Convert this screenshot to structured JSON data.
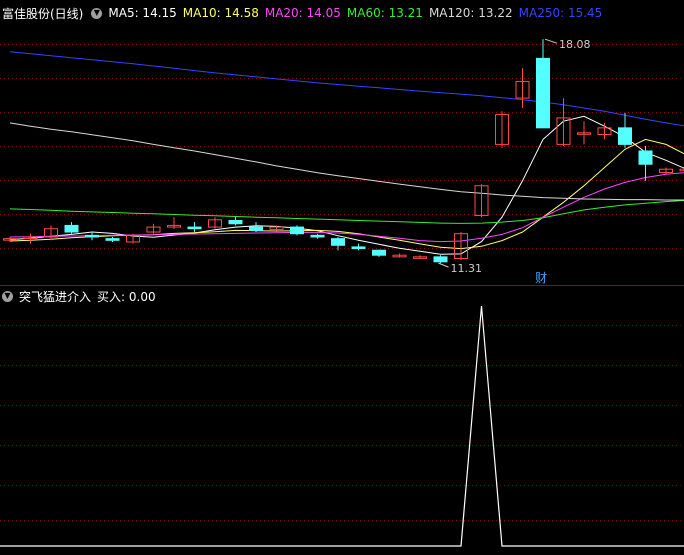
{
  "stock_name": "富佳股份(日线)",
  "ma_legend": [
    {
      "label": "MA5: 14.15",
      "color": "#ffffff"
    },
    {
      "label": "MA10: 14.58",
      "color": "#ffff66"
    },
    {
      "label": "MA20: 14.05",
      "color": "#ff44ff"
    },
    {
      "label": "MA60: 13.21",
      "color": "#33ee33"
    },
    {
      "label": "MA120: 13.22",
      "color": "#d8d8d8"
    },
    {
      "label": "MA250: 15.45",
      "color": "#3344ff"
    }
  ],
  "indicator_name": "突飞猛进介入",
  "indicator_value": "买入: 0.00",
  "annotations": {
    "high": "18.08",
    "low": "11.31",
    "marker": "财"
  },
  "colors": {
    "up": "#ff4a4a",
    "down": "#54ffff",
    "grid": "#8a0000",
    "marker": "#3aa0ff"
  },
  "chart_data": {
    "type": "candlestick",
    "price_range": [
      10.8,
      18.6
    ],
    "candles": [
      {
        "o": 12.05,
        "c": 12.05,
        "h": 12.1,
        "l": 11.95
      },
      {
        "o": 12.08,
        "c": 12.1,
        "h": 12.2,
        "l": 11.9
      },
      {
        "o": 12.1,
        "c": 12.35,
        "h": 12.45,
        "l": 12.0
      },
      {
        "o": 12.45,
        "c": 12.25,
        "h": 12.55,
        "l": 12.2
      },
      {
        "o": 12.15,
        "c": 12.1,
        "h": 12.25,
        "l": 12.0
      },
      {
        "o": 12.05,
        "c": 12.0,
        "h": 12.1,
        "l": 11.95
      },
      {
        "o": 11.95,
        "c": 12.15,
        "h": 12.2,
        "l": 11.9
      },
      {
        "o": 12.25,
        "c": 12.4,
        "h": 12.5,
        "l": 12.2
      },
      {
        "o": 12.4,
        "c": 12.45,
        "h": 12.7,
        "l": 12.35
      },
      {
        "o": 12.4,
        "c": 12.35,
        "h": 12.55,
        "l": 12.25
      },
      {
        "o": 12.4,
        "c": 12.62,
        "h": 12.7,
        "l": 12.35
      },
      {
        "o": 12.6,
        "c": 12.5,
        "h": 12.7,
        "l": 12.45
      },
      {
        "o": 12.4,
        "c": 12.3,
        "h": 12.55,
        "l": 12.25
      },
      {
        "o": 12.33,
        "c": 12.4,
        "h": 12.45,
        "l": 12.3
      },
      {
        "o": 12.4,
        "c": 12.2,
        "h": 12.45,
        "l": 12.15
      },
      {
        "o": 12.15,
        "c": 12.1,
        "h": 12.2,
        "l": 12.05
      },
      {
        "o": 12.05,
        "c": 11.85,
        "h": 12.1,
        "l": 11.7
      },
      {
        "o": 11.8,
        "c": 11.75,
        "h": 11.9,
        "l": 11.7
      },
      {
        "o": 11.7,
        "c": 11.55,
        "h": 11.72,
        "l": 11.5
      },
      {
        "o": 11.5,
        "c": 11.55,
        "h": 11.6,
        "l": 11.48
      },
      {
        "o": 11.48,
        "c": 11.5,
        "h": 11.55,
        "l": 11.45
      },
      {
        "o": 11.5,
        "c": 11.35,
        "h": 11.55,
        "l": 11.31
      },
      {
        "o": 11.45,
        "c": 12.2,
        "h": 12.25,
        "l": 11.4
      },
      {
        "o": 12.75,
        "c": 13.65,
        "h": 13.7,
        "l": 12.7
      },
      {
        "o": 14.9,
        "c": 15.8,
        "h": 15.9,
        "l": 14.8
      },
      {
        "o": 16.3,
        "c": 16.8,
        "h": 17.2,
        "l": 16.0
      },
      {
        "o": 17.5,
        "c": 15.4,
        "h": 18.08,
        "l": 15.4
      },
      {
        "o": 14.9,
        "c": 15.7,
        "h": 16.3,
        "l": 14.85
      },
      {
        "o": 15.25,
        "c": 15.25,
        "h": 15.6,
        "l": 14.9
      },
      {
        "o": 15.2,
        "c": 15.4,
        "h": 15.55,
        "l": 15.05
      },
      {
        "o": 15.4,
        "c": 14.9,
        "h": 15.85,
        "l": 14.8
      },
      {
        "o": 14.7,
        "c": 14.3,
        "h": 14.85,
        "l": 13.8
      },
      {
        "o": 14.05,
        "c": 14.15,
        "h": 14.2,
        "l": 14.0
      },
      {
        "o": 14.1,
        "c": 14.15,
        "h": 14.45,
        "l": 14.0
      }
    ],
    "ma_series": [
      {
        "name": "MA5",
        "color": "#ffffff",
        "values": [
          12.02,
          12.06,
          12.12,
          12.18,
          12.25,
          12.21,
          12.13,
          12.09,
          12.16,
          12.22,
          12.32,
          12.4,
          12.44,
          12.42,
          12.37,
          12.29,
          12.14,
          12.0,
          11.88,
          11.76,
          11.67,
          11.58,
          11.59,
          11.96,
          12.7,
          13.8,
          15.05,
          15.6,
          15.75,
          15.45,
          15.12,
          14.66,
          14.42,
          14.15
        ]
      },
      {
        "name": "MA10",
        "color": "#ffff66",
        "values": [
          11.98,
          12.0,
          12.03,
          12.08,
          12.11,
          12.14,
          12.15,
          12.17,
          12.21,
          12.23,
          12.26,
          12.3,
          12.29,
          12.28,
          12.29,
          12.3,
          12.27,
          12.2,
          12.1,
          12.0,
          11.89,
          11.79,
          11.75,
          11.82,
          11.99,
          12.25,
          12.7,
          13.15,
          13.65,
          14.2,
          14.75,
          15.05,
          14.9,
          14.58
        ]
      },
      {
        "name": "MA20",
        "color": "#ff44ff",
        "values": [
          12.1,
          12.11,
          12.12,
          12.13,
          12.14,
          12.15,
          12.16,
          12.17,
          12.18,
          12.19,
          12.2,
          12.21,
          12.22,
          12.23,
          12.24,
          12.24,
          12.22,
          12.18,
          12.12,
          12.06,
          11.99,
          11.96,
          11.98,
          12.06,
          12.18,
          12.38,
          12.7,
          13.0,
          13.3,
          13.55,
          13.75,
          13.9,
          14.0,
          14.05
        ]
      },
      {
        "name": "MA60",
        "color": "#33ee33",
        "values": [
          12.95,
          12.93,
          12.91,
          12.88,
          12.86,
          12.84,
          12.82,
          12.8,
          12.78,
          12.76,
          12.74,
          12.72,
          12.7,
          12.68,
          12.66,
          12.64,
          12.62,
          12.6,
          12.58,
          12.56,
          12.54,
          12.52,
          12.51,
          12.52,
          12.55,
          12.6,
          12.68,
          12.8,
          12.92,
          13.0,
          13.07,
          13.12,
          13.17,
          13.21
        ]
      },
      {
        "name": "MA120",
        "color": "#d8d8d8",
        "values": [
          15.55,
          15.45,
          15.36,
          15.28,
          15.19,
          15.1,
          15.01,
          14.9,
          14.8,
          14.7,
          14.59,
          14.48,
          14.37,
          14.25,
          14.15,
          14.04,
          13.95,
          13.87,
          13.78,
          13.7,
          13.62,
          13.54,
          13.47,
          13.42,
          13.37,
          13.33,
          13.29,
          13.27,
          13.25,
          13.24,
          13.23,
          13.23,
          13.22,
          13.22
        ]
      },
      {
        "name": "MA250",
        "color": "#3344ff",
        "values": [
          17.7,
          17.64,
          17.58,
          17.52,
          17.46,
          17.4,
          17.34,
          17.27,
          17.2,
          17.13,
          17.06,
          17.0,
          16.94,
          16.88,
          16.82,
          16.76,
          16.71,
          16.66,
          16.61,
          16.56,
          16.51,
          16.46,
          16.42,
          16.37,
          16.31,
          16.25,
          16.18,
          16.1,
          16.0,
          15.9,
          15.78,
          15.66,
          15.55,
          15.45
        ]
      }
    ],
    "indicator": {
      "name": "买入",
      "values": [
        0,
        0,
        0,
        0,
        0,
        0,
        0,
        0,
        0,
        0,
        0,
        0,
        0,
        0,
        0,
        0,
        0,
        0,
        0,
        0,
        0,
        0,
        0,
        1,
        0,
        0,
        0,
        0,
        0,
        0,
        0,
        0,
        0,
        0
      ]
    }
  }
}
